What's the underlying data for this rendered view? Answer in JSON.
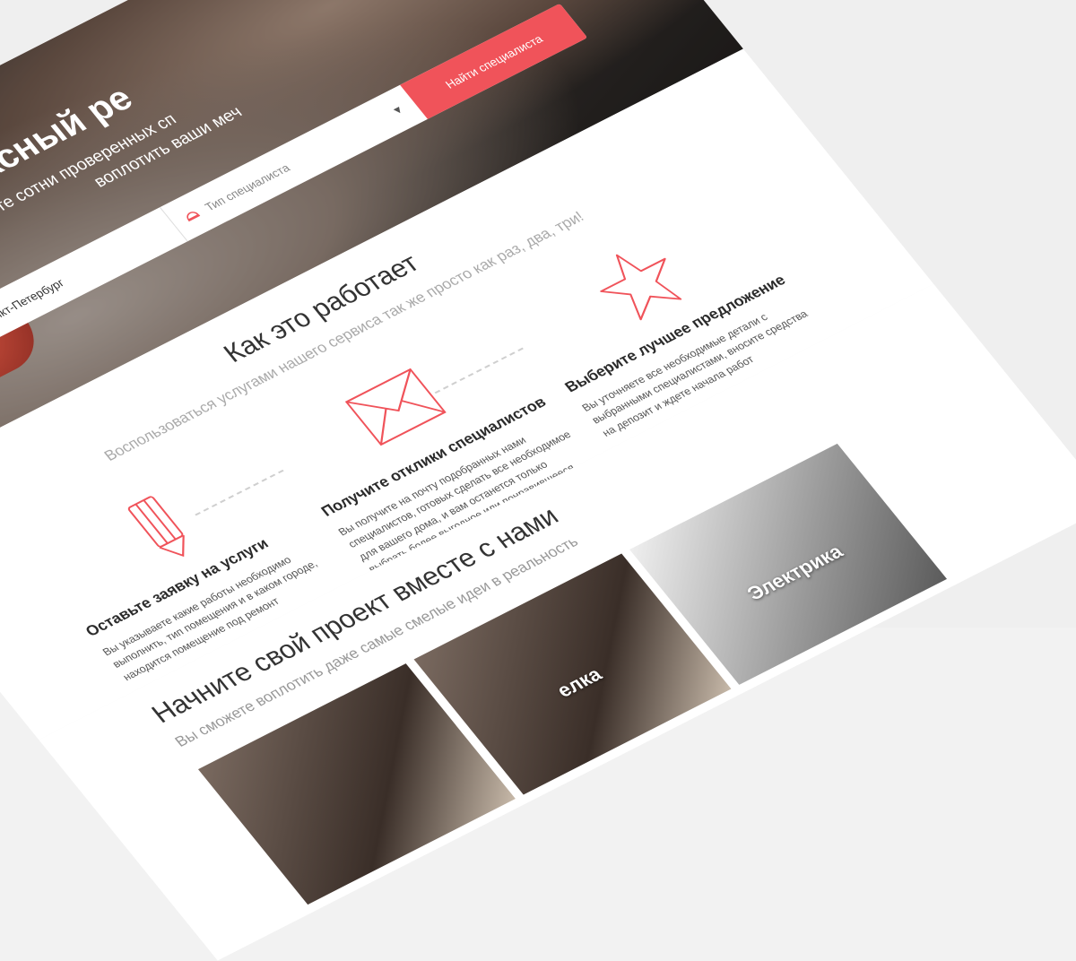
{
  "hero": {
    "title": "Комплексный ре",
    "subtitle_line1": "У нас вы найдете сотни проверенных сп",
    "subtitle_line2": "воплотить ваши меч",
    "city_value": "Санкт-Петербург",
    "type_placeholder": "Тип специалиста",
    "find_button": "Найти специалиста"
  },
  "how": {
    "title": "Как это работает",
    "subtitle": "Воспользоваться услугами нашего сервиса так же просто как раз, два, три!",
    "steps": [
      {
        "title": "Оставьте заявку на услуги",
        "text": "Вы указываете какие работы необходимо выполнить, тип помещения и в каком городе, находится помещение под ремонт"
      },
      {
        "title": "Получите отклики специалистов",
        "text": "Вы получите на почту подобранных нами специалистов, готовых сделать все необходимое для вашего дома, и вам останется только выбрать более выгодное или понравившееся предложение."
      },
      {
        "title": "Выберите лучшее предложение",
        "text": "Вы уточняете все необходимые детали с выбранными специалистами, вносите средства на депозит и ждете начала работ"
      }
    ]
  },
  "project": {
    "title": "Начните свой проект вместе с нами",
    "subtitle": "Вы сможете воплотить даже самые смелые идеи в реальность",
    "cards": [
      {
        "label": ""
      },
      {
        "label": "елка"
      },
      {
        "label": "Электрика"
      }
    ]
  },
  "colors": {
    "accent": "#f0535a"
  }
}
